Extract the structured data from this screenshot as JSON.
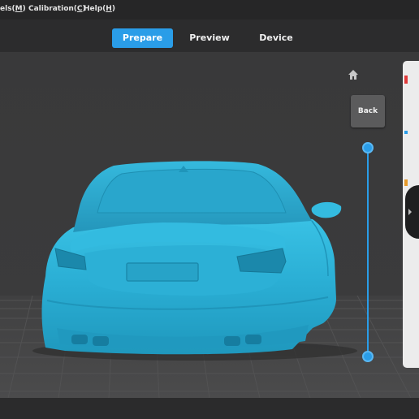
{
  "menu": {
    "items": [
      {
        "label": "els(M)"
      },
      {
        "label": "Calibration(C)"
      },
      {
        "label": "Help(H)"
      }
    ]
  },
  "tabs": [
    {
      "label": "Prepare",
      "active": true
    },
    {
      "label": "Preview",
      "active": false
    },
    {
      "label": "Device",
      "active": false
    }
  ],
  "view_controls": {
    "home_icon": "home-icon",
    "back_label": "Back"
  },
  "layer_slider": {
    "top_level": 1.0,
    "bottom_level": 0.0
  },
  "colors": {
    "accent": "#2a9de8",
    "model": "#2fb4d8",
    "plate": "#4a4a4b"
  }
}
